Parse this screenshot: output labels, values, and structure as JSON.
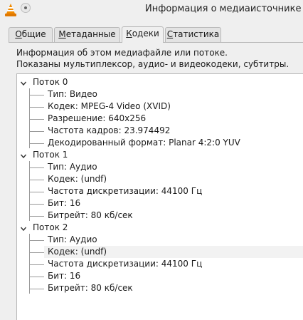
{
  "window": {
    "title": "Информация о медиаисточнике"
  },
  "icons": {
    "app": "vlc-cone-icon",
    "help": "help-icon",
    "expand": "expanded-arrow-icon"
  },
  "tabs": [
    {
      "label_pre": "",
      "label_ul": "О",
      "label_post": "бщие",
      "active": false
    },
    {
      "label_pre": "",
      "label_ul": "М",
      "label_post": "етаданные",
      "active": false
    },
    {
      "label_pre": "",
      "label_ul": "К",
      "label_post": "одеки",
      "active": true
    },
    {
      "label_pre": "",
      "label_ul": "С",
      "label_post": "татистика",
      "active": false
    }
  ],
  "info": {
    "line1": "Информация об этом медиафайле или потоке.",
    "line2": "Показаны мультиплексор, аудио- и видеокодеки, субтитры."
  },
  "streams": [
    {
      "label": "Поток 0",
      "items": [
        "Тип: Видео",
        "Кодек: MPEG-4 Video (XVID)",
        "Разрешение: 640x256",
        "Частота кадров: 23.974492",
        "Декодированный формат: Planar 4:2:0 YUV"
      ]
    },
    {
      "label": "Поток 1",
      "items": [
        "Тип: Аудио",
        "Кодек:  (undf)",
        "Частота дискретизации: 44100 Гц",
        "Бит: 16",
        "Битрейт: 80 кб/сек"
      ]
    },
    {
      "label": "Поток 2",
      "items": [
        "Тип: Аудио",
        "Кодек:  (undf)",
        "Частота дискретизации: 44100 Гц",
        "Бит: 16",
        "Битрейт: 80 кб/сек"
      ]
    }
  ]
}
